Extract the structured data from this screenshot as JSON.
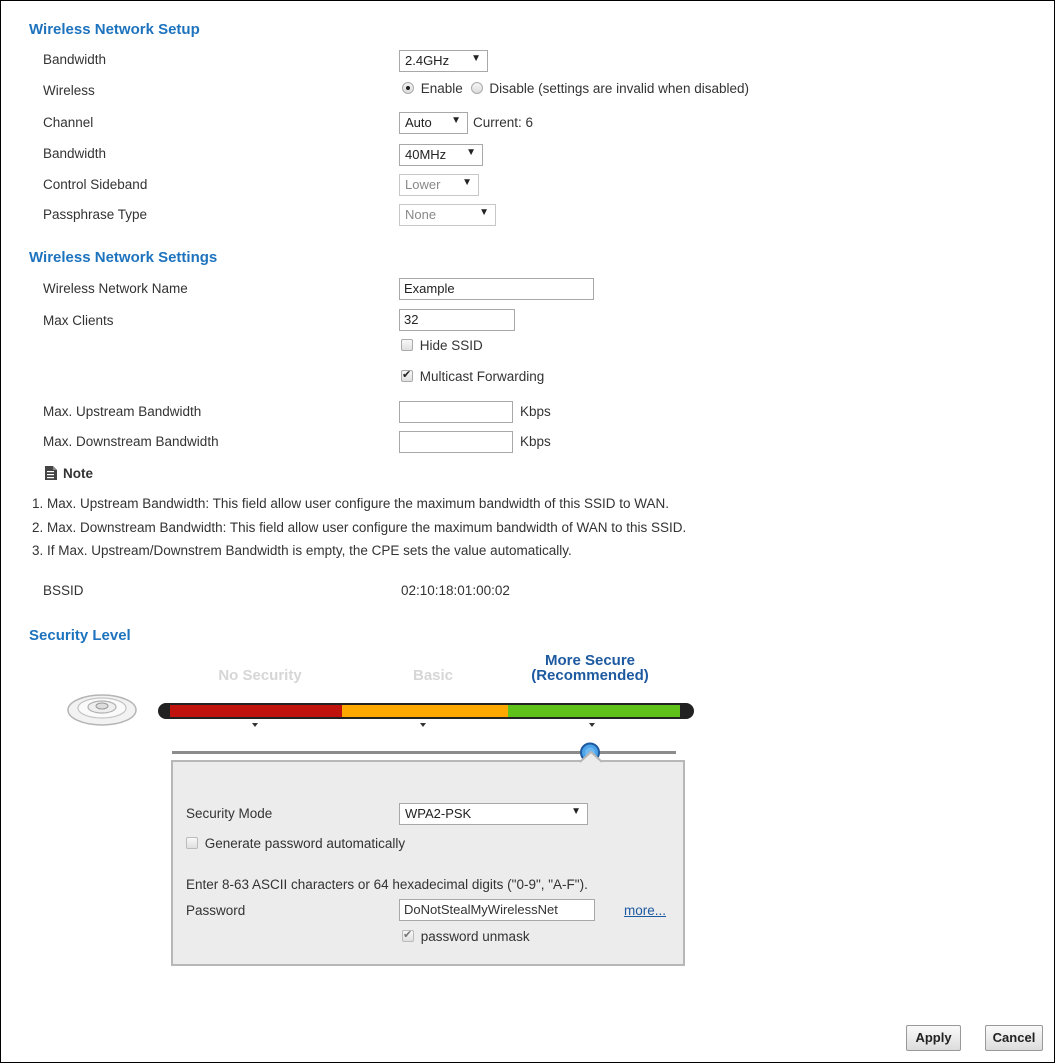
{
  "setup": {
    "title": "Wireless Network Setup",
    "bandwidth_label": "Bandwidth",
    "bandwidth_value": "2.4GHz",
    "wireless_label": "Wireless",
    "enable_label": "Enable",
    "disable_label": "Disable (settings are invalid when disabled)",
    "channel_label": "Channel",
    "channel_value": "Auto",
    "current_channel": "Current: 6",
    "bandwidth2_label": "Bandwidth",
    "bandwidth2_value": "40MHz",
    "sideband_label": "Control Sideband",
    "sideband_value": "Lower",
    "passphrase_label": "Passphrase Type",
    "passphrase_value": "None"
  },
  "settings": {
    "title": "Wireless Network Settings",
    "ssid_label": "Wireless Network Name",
    "ssid_value": "Example",
    "max_clients_label": "Max Clients",
    "max_clients_value": "32",
    "hide_ssid_label": "Hide SSID",
    "hide_ssid_checked": false,
    "multicast_label": "Multicast Forwarding",
    "multicast_checked": true,
    "upstream_label": "Max. Upstream Bandwidth",
    "upstream_value": "",
    "upstream_unit": "Kbps",
    "downstream_label": "Max. Downstream Bandwidth",
    "downstream_value": "",
    "downstream_unit": "Kbps",
    "note_title": "Note",
    "notes": [
      "1. Max. Upstream Bandwidth: This field allow user configure the maximum bandwidth of this SSID to WAN.",
      "2. Max. Downstream Bandwidth: This field allow user configure the maximum bandwidth of WAN to this SSID.",
      "3. If Max. Upstream/Downstrem Bandwidth is empty, the CPE sets the value automatically."
    ],
    "bssid_label": "BSSID",
    "bssid_value": "02:10:18:01:00:02"
  },
  "security": {
    "title": "Security Level",
    "levels": [
      "No Security",
      "Basic",
      "More Secure\n(Recommended)"
    ],
    "level_line1": "More Secure",
    "level_line2": "(Recommended)",
    "selected_level": "More Secure (Recommended)",
    "colors": {
      "red": "#c0130d",
      "orange": "#ffa800",
      "green": "#5ec21a",
      "selected_text": "#1e5aa0",
      "inactive_text": "#d6d6d6"
    },
    "mode_label": "Security Mode",
    "mode_value": "WPA2-PSK",
    "generate_label": "Generate password automatically",
    "generate_checked": false,
    "hint": "Enter 8-63 ASCII characters or 64 hexadecimal digits (\"0-9\", \"A-F\").",
    "password_label": "Password",
    "password_value": "DoNotStealMyWirelessNet",
    "more_link": "more...",
    "unmask_label": "password unmask",
    "unmask_checked": true
  },
  "buttons": {
    "apply": "Apply",
    "cancel": "Cancel"
  }
}
